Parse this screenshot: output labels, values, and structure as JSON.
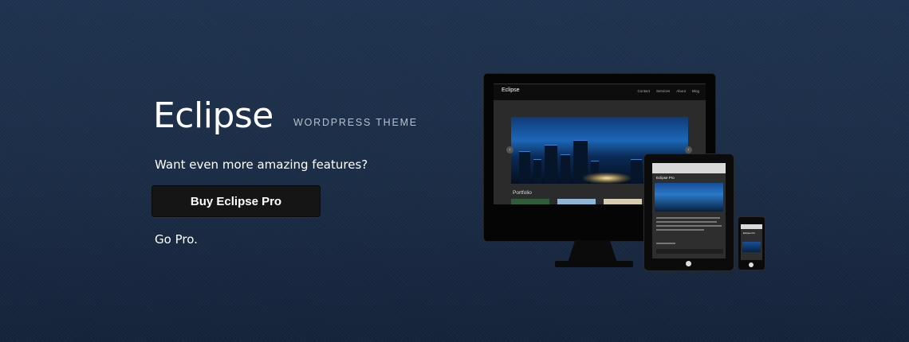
{
  "hero": {
    "brand": "Eclipse",
    "tagline": "WORDPRESS THEME",
    "headline": "Want even more amazing features?",
    "buy_button": "Buy Eclipse Pro",
    "go_pro_link": "Go Pro."
  },
  "mockup": {
    "site_logo": "Eclipse",
    "nav": [
      "Contact",
      "Services",
      "About",
      "Blog"
    ],
    "slider_prev_icon": "chevron-left-icon",
    "slider_next_icon": "chevron-right-icon",
    "section_label": "Portfolio",
    "tablet_logo": "Eclipse Pro",
    "phone_logo": "Eclipse Pro"
  },
  "colors": {
    "background": "#1c2e48",
    "button_bg": "#151515",
    "text": "#ffffff",
    "tagline": "#b8c0cc"
  }
}
